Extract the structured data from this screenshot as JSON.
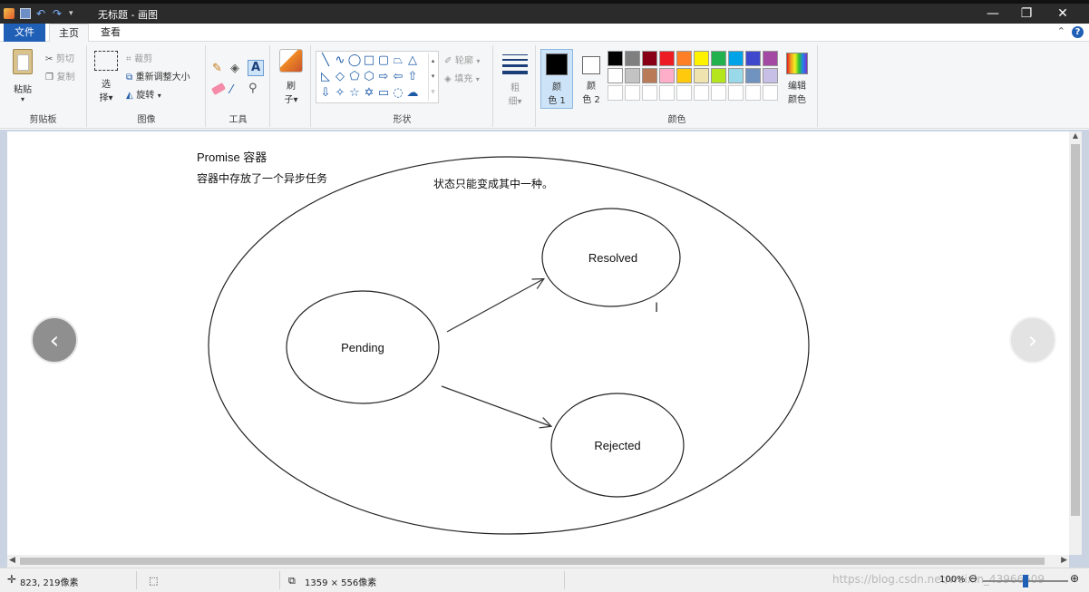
{
  "titlebar": {
    "title": "无标题 - 画图",
    "minimize": "—",
    "restore": "❐",
    "close": "✕"
  },
  "tabs": {
    "file": "文件",
    "home": "主页",
    "view": "查看"
  },
  "ribbon": {
    "clipboard": {
      "paste": "粘贴",
      "cut": "剪切",
      "copy": "复制",
      "label": "剪贴板"
    },
    "image": {
      "select_line1": "选",
      "select_line2": "择",
      "crop": "裁剪",
      "resize": "重新调整大小",
      "rotate": "旋转",
      "label": "图像"
    },
    "tools": {
      "label": "工具"
    },
    "brush": {
      "line1": "刷",
      "line2": "子"
    },
    "shapes": {
      "outline": "轮廓",
      "fill": "填充",
      "label": "形状"
    },
    "size": {
      "line1": "粗",
      "line2": "细"
    },
    "colors": {
      "color1_line1": "颜",
      "color1_line2": "色 1",
      "color2_line1": "颜",
      "color2_line2": "色 2",
      "edit_line1": "编辑",
      "edit_line2": "颜色",
      "label": "颜色",
      "palette_row1": [
        "#000000",
        "#7f7f7f",
        "#880015",
        "#ed1c24",
        "#ff7f27",
        "#fff200",
        "#22b14c",
        "#00a2e8",
        "#3f48cc",
        "#a349a4"
      ],
      "palette_row2": [
        "#ffffff",
        "#c3c3c3",
        "#b97a57",
        "#ffaec9",
        "#ffc90e",
        "#efe4b0",
        "#b5e61d",
        "#99d9ea",
        "#7092be",
        "#c8bfe7"
      ],
      "primary": "#000000",
      "secondary": "#ffffff"
    }
  },
  "drawing": {
    "promise_title": "Promise 容器",
    "promise_desc": "容器中存放了一个异步任务",
    "state_note": "状态只能变成其中一种。",
    "pending": "Pending",
    "resolved": "Resolved",
    "rejected": "Rejected"
  },
  "statusbar": {
    "cursor_pos": "823, 219像素",
    "canvas_size": "1359 × 556像素",
    "zoom": "100%",
    "watermark": "https://blog.csdn.net/weixin_43966609"
  }
}
